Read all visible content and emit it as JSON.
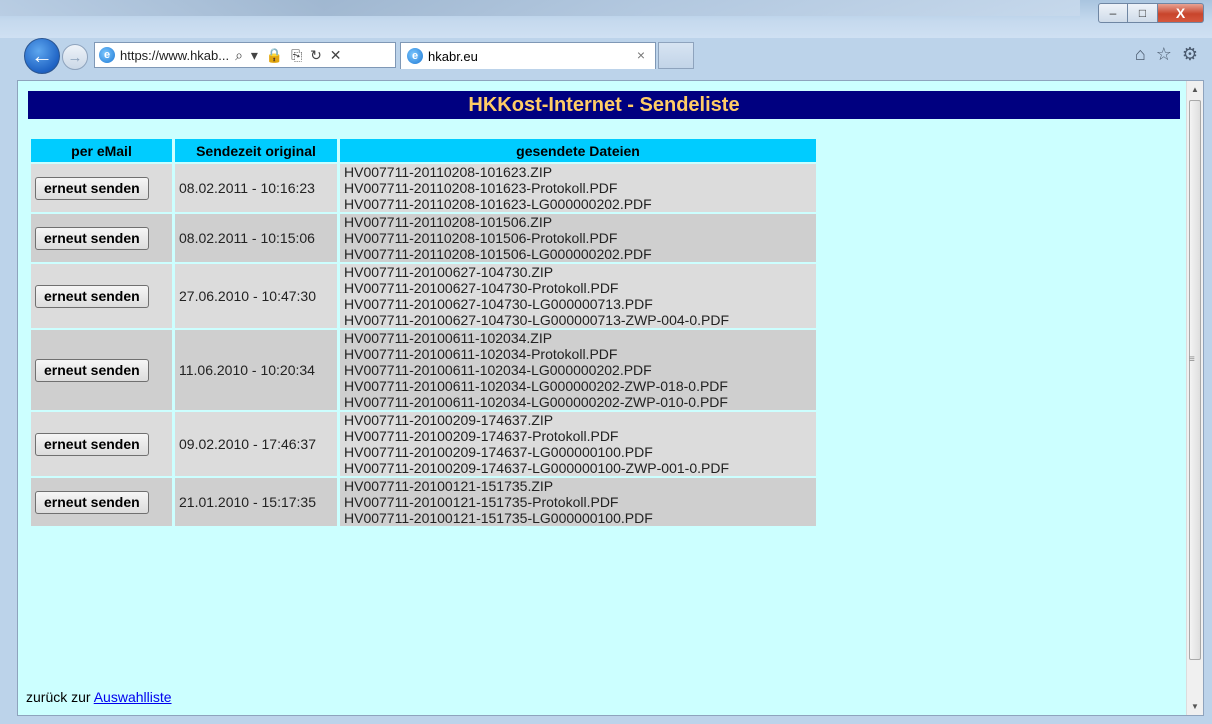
{
  "window": {
    "minimize": "–",
    "maximize": "□",
    "close": "X"
  },
  "browser": {
    "url": "https://www.hkab...",
    "address_tools": "⌕ ▾ 🔒 ⎘ ↻ ✕",
    "tab_title": "hkabr.eu",
    "tab_close": "×",
    "home_icon": "⌂",
    "favorites_icon": "☆",
    "settings_icon": "⚙"
  },
  "page": {
    "title": "HKKost-Internet - Sendeliste",
    "back_text": "zurück zur",
    "back_link": "Auswahlliste"
  },
  "table": {
    "headers": [
      "per eMail",
      "Sendezeit original",
      "gesendete Dateien"
    ],
    "button_label": "erneut senden",
    "rows": [
      {
        "time": "08.02.2011 - 10:16:23",
        "files": [
          "HV007711-20110208-101623.ZIP",
          "HV007711-20110208-101623-Protokoll.PDF",
          "HV007711-20110208-101623-LG000000202.PDF"
        ]
      },
      {
        "time": "08.02.2011 - 10:15:06",
        "files": [
          "HV007711-20110208-101506.ZIP",
          "HV007711-20110208-101506-Protokoll.PDF",
          "HV007711-20110208-101506-LG000000202.PDF"
        ]
      },
      {
        "time": "27.06.2010 - 10:47:30",
        "files": [
          "HV007711-20100627-104730.ZIP",
          "HV007711-20100627-104730-Protokoll.PDF",
          "HV007711-20100627-104730-LG000000713.PDF",
          "HV007711-20100627-104730-LG000000713-ZWP-004-0.PDF"
        ]
      },
      {
        "time": "11.06.2010 - 10:20:34",
        "files": [
          "HV007711-20100611-102034.ZIP",
          "HV007711-20100611-102034-Protokoll.PDF",
          "HV007711-20100611-102034-LG000000202.PDF",
          "HV007711-20100611-102034-LG000000202-ZWP-018-0.PDF",
          "HV007711-20100611-102034-LG000000202-ZWP-010-0.PDF"
        ]
      },
      {
        "time": "09.02.2010 - 17:46:37",
        "files": [
          "HV007711-20100209-174637.ZIP",
          "HV007711-20100209-174637-Protokoll.PDF",
          "HV007711-20100209-174637-LG000000100.PDF",
          "HV007711-20100209-174637-LG000000100-ZWP-001-0.PDF"
        ]
      },
      {
        "time": "21.01.2010 - 15:17:35",
        "files": [
          "HV007711-20100121-151735.ZIP",
          "HV007711-20100121-151735-Protokoll.PDF",
          "HV007711-20100121-151735-LG000000100.PDF"
        ]
      }
    ]
  },
  "colors": {
    "page_bg": "#ccffff",
    "header_bg": "#000080",
    "header_text": "#ffcc66",
    "th_bg": "#00ccff",
    "row_odd": "#dcdcdc",
    "row_even": "#cfcfcf"
  }
}
